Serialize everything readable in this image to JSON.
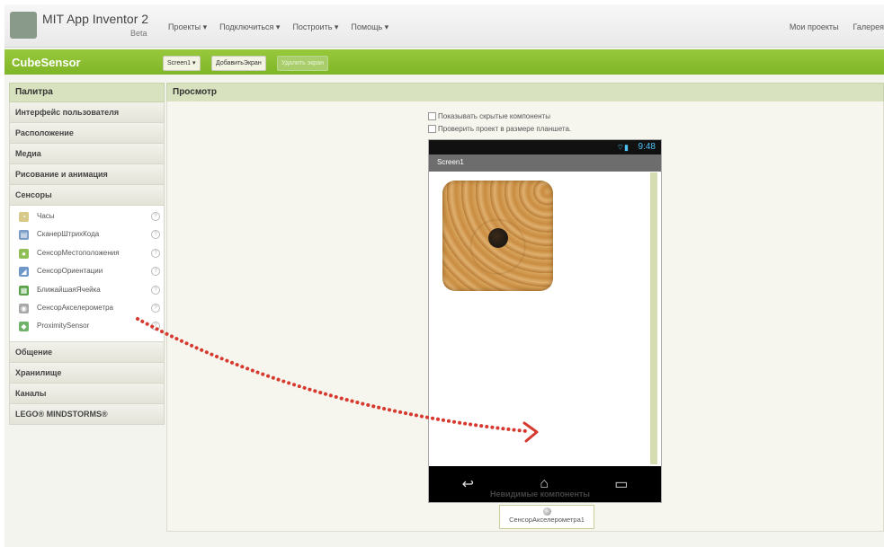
{
  "app": {
    "title": "MIT App Inventor 2",
    "beta": "Beta"
  },
  "top_nav": {
    "items": [
      "Проекты ▾",
      "Подключиться ▾",
      "Построить ▾",
      "Помощь ▾"
    ],
    "right": [
      "Мои проекты",
      "Галерея"
    ]
  },
  "project": {
    "name": "CubeSensor",
    "screen_button": "Screen1 ▾",
    "add_screen": "ДобавитьЭкран",
    "remove_screen": "Удалить экран"
  },
  "palette": {
    "title": "Палитра",
    "categories_top": [
      "Интерфейс пользователя",
      "Расположение",
      "Медиа",
      "Рисование и анимация",
      "Сенсоры"
    ],
    "sensor_items": [
      {
        "label": "Часы",
        "icon": "clock-icon",
        "color": "#d6c98a",
        "glyph": "◔"
      },
      {
        "label": "СканерШтрихКода",
        "icon": "barcode-icon",
        "color": "#7a9cc6",
        "glyph": "▤"
      },
      {
        "label": "СенсорМестоположения",
        "icon": "location-icon",
        "color": "#8fbf56",
        "glyph": "●"
      },
      {
        "label": "СенсорОриентации",
        "icon": "orientation-icon",
        "color": "#6f98c8",
        "glyph": "◢"
      },
      {
        "label": "БлижайшаяЯчейка",
        "icon": "nfc-icon",
        "color": "#5aa24a",
        "glyph": "▦"
      },
      {
        "label": "СенсорАкселерометра",
        "icon": "accelerometer-icon",
        "color": "#a8a8a8",
        "glyph": "◉"
      },
      {
        "label": "ProximitySensor",
        "icon": "proximity-icon",
        "color": "#6fb36a",
        "glyph": "◆"
      }
    ],
    "help_glyph": "?",
    "categories_bottom": [
      "Общение",
      "Хранилище",
      "Каналы",
      "LEGO® MINDSTORMS®"
    ]
  },
  "viewer": {
    "title": "Просмотр",
    "show_hidden": "Показывать скрытые компоненты",
    "tablet_size": "Проверить проект в размере планшета.",
    "status_time": "9:48",
    "status_icons": "⌔▮",
    "screen_title": "Screen1",
    "nav_buttons": [
      "↩",
      "⌂",
      "▭"
    ],
    "nonvisible_label": "Невидимые компоненты",
    "nonvisible_component": "СенсорАкселерометра1"
  },
  "colors": {
    "accent_green": "#8dc033",
    "arrow": "#d63a2f"
  }
}
